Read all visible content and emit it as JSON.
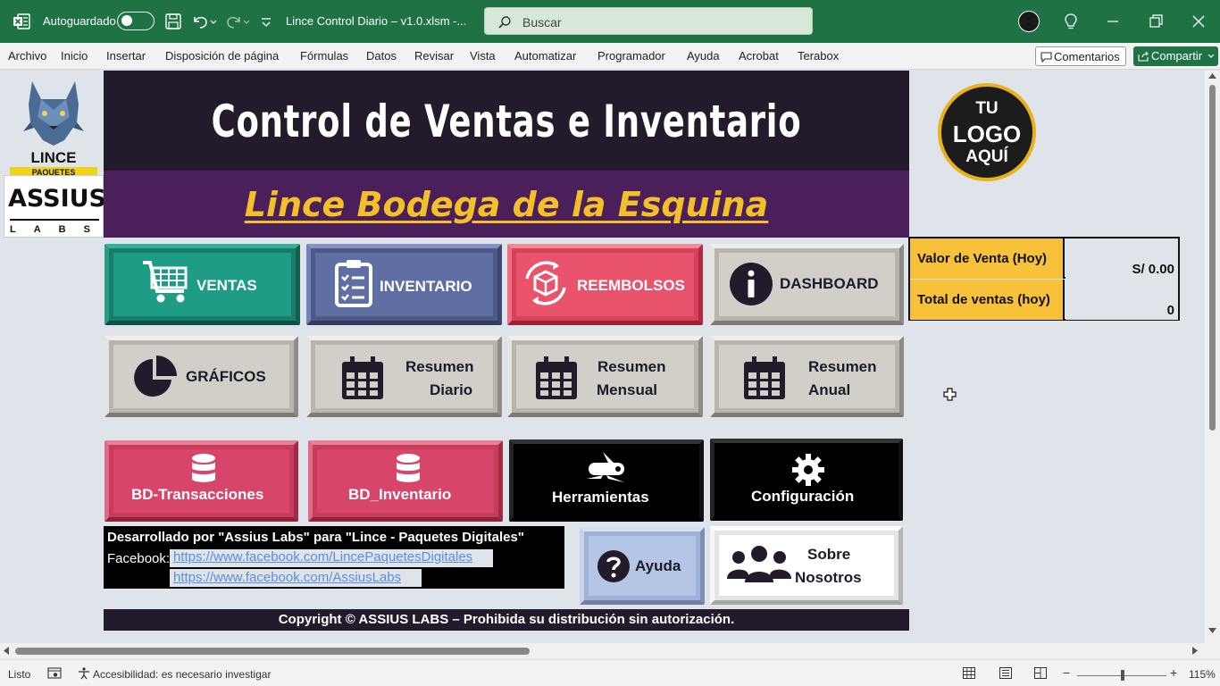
{
  "titlebar": {
    "autosave_label": "Autoguardado",
    "file_title": "Lince Control Diario – v1.0.xlsm  -...",
    "search_placeholder": "Buscar"
  },
  "menu": {
    "items": [
      "Archivo",
      "Inicio",
      "Insertar",
      "Disposición de página",
      "Fórmulas",
      "Datos",
      "Revisar",
      "Vista",
      "Automatizar",
      "Programador",
      "Ayuda",
      "Acrobat",
      "Terabox"
    ],
    "comentarios": "Comentarios",
    "compartir": "Compartir"
  },
  "logos": {
    "lince": "LINCE",
    "lince_sub": "PAQUETES DIGITALES",
    "assius": "ASSIUS",
    "assius_sub": "LABS",
    "your_logo_1": "TU",
    "your_logo_2": "LOGO",
    "your_logo_3": "AQUÍ"
  },
  "header": {
    "title": "Control de Ventas e Inventario",
    "subtitle": "Lince Bodega de la Esquina"
  },
  "kpi": {
    "sale_value_label": "Valor de Venta (Hoy)",
    "sale_value": "S/ 0.00",
    "total_sales_label": "Total de ventas (hoy)",
    "total_sales": "0"
  },
  "buttons": {
    "ventas": "VENTAS",
    "inventario": "INVENTARIO",
    "reembolsos": "REEMBOLSOS",
    "dashboard": "DASHBOARD",
    "graficos": "GRÁFICOS",
    "resumen_diario_1": "Resumen",
    "resumen_diario_2": "Diario",
    "resumen_mensual_1": "Resumen",
    "resumen_mensual_2": "Mensual",
    "resumen_anual_1": "Resumen",
    "resumen_anual_2": "Anual",
    "bd_transacciones": "BD-Transacciones",
    "bd_inventario": "BD_Inventario",
    "herramientas": "Herramientas",
    "configuracion": "Configuración",
    "ayuda": "Ayuda",
    "sobre_1": "Sobre",
    "sobre_2": "Nosotros"
  },
  "footer": {
    "developed_by": "Desarrollado por \"Assius Labs\" para \"Lince - Paquetes Digitales\"",
    "facebook_label": "Facebook:",
    "link1": "https://www.facebook.com/LincePaquetesDigitales",
    "link2": "https://www.facebook.com/AssiusLabs",
    "copyright": "Copyright © ASSIUS LABS – Prohibida su distribución sin autorización."
  },
  "statusbar": {
    "ready": "Listo",
    "accessibility": "Accesibilidad: es necesario investigar",
    "zoom": "115%"
  },
  "colors": {
    "excel_green": "#1f7244",
    "header_dark": "#231a2c",
    "header_purple": "#4b1f59",
    "subtitle_gold": "#f3c02a",
    "kpi_yellow": "#f7c13a"
  }
}
